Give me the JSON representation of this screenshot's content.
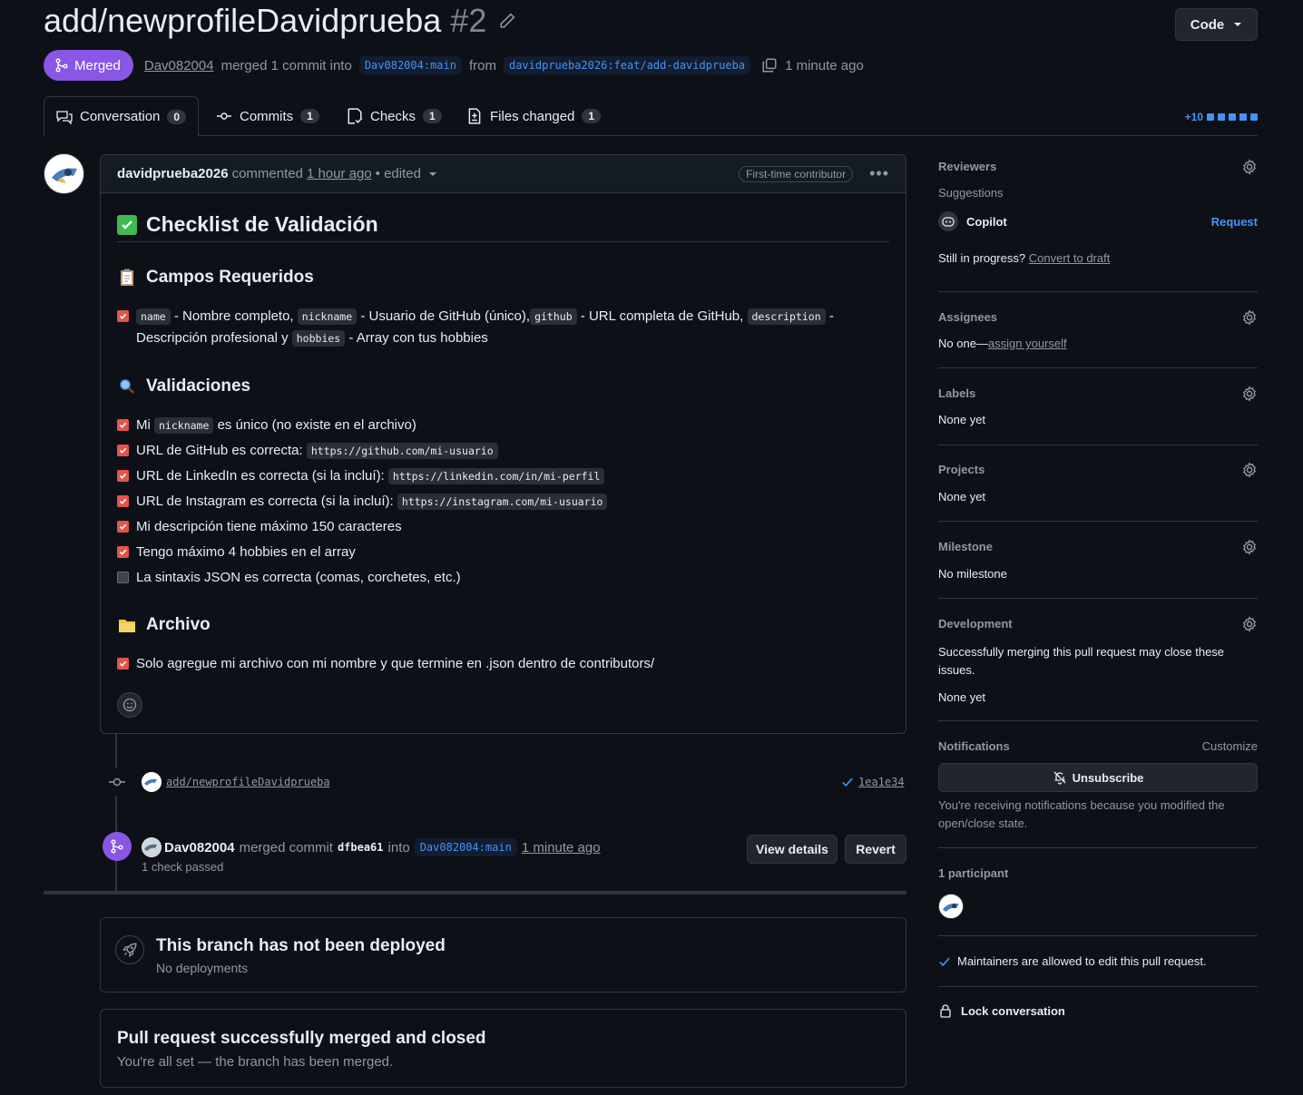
{
  "pr": {
    "title": "add/newprofileDavidprueba",
    "number": "#2",
    "state": "Merged",
    "author": "Dav082004",
    "merged_text": "merged 1 commit into",
    "base_branch": "Dav082004:main",
    "from_text": "from",
    "head_branch": "davidprueba2026:feat/add-davidprueba",
    "time": "1 minute ago"
  },
  "code_button": "Code",
  "tabs": [
    {
      "label": "Conversation",
      "count": "0"
    },
    {
      "label": "Commits",
      "count": "1"
    },
    {
      "label": "Checks",
      "count": "1"
    },
    {
      "label": "Files changed",
      "count": "1"
    }
  ],
  "diffstat": "+10",
  "comment": {
    "author": "davidprueba2026",
    "action": "commented",
    "time": "1 hour ago",
    "edited": "• edited",
    "badge": "First-time contributor",
    "heading": "Checklist de Validación",
    "sections": [
      {
        "title": "Campos Requeridos"
      },
      {
        "title": "Validaciones"
      },
      {
        "title": "Archivo"
      }
    ],
    "req": {
      "c1": "name",
      "t1": "- Nombre completo,",
      "c2": "nickname",
      "t2": "- Usuario de GitHub (único),",
      "c3": "github",
      "t3": "- URL completa de GitHub,",
      "c4": "description",
      "t4": "-",
      "t5": "Descripción profesional y",
      "c5": "hobbies",
      "t6": "- Array con tus hobbies"
    },
    "val": {
      "v1a": "Mi",
      "v1c": "nickname",
      "v1b": "es único (no existe en el archivo)",
      "v2a": "URL de GitHub es correcta:",
      "v2c": "https://github.com/mi-usuario",
      "v3a": "URL de LinkedIn es correcta (si la incluí):",
      "v3c": "https://linkedin.com/in/mi-perfil",
      "v4a": "URL de Instagram es correcta (si la incluí):",
      "v4c": "https://instagram.com/mi-usuario",
      "v5": "Mi descripción tiene máximo 150 caracteres",
      "v6": "Tengo máximo 4 hobbies en el array",
      "v7": "La sintaxis JSON es correcta (comas, corchetes, etc.)"
    },
    "file_item": "Solo agregue mi archivo con mi nombre y que termine en .json dentro de contributors/"
  },
  "timeline": {
    "commit_msg": "add/newprofileDavidprueba",
    "commit_sha": "1ea1e34",
    "merge_author": "Dav082004",
    "merge_text": "merged commit",
    "merge_sha": "dfbea61",
    "into": "into",
    "merge_branch": "Dav082004:main",
    "merge_time": "1 minute ago",
    "checks": "1 check passed",
    "view_details": "View details",
    "revert": "Revert"
  },
  "deploy": {
    "title": "This branch has not been deployed",
    "subtitle": "No deployments"
  },
  "merged_box": {
    "title": "Pull request successfully merged and closed",
    "subtitle": "You're all set — the branch has been merged."
  },
  "sidebar": {
    "reviewers": "Reviewers",
    "suggestions": "Suggestions",
    "copilot": "Copilot",
    "request": "Request",
    "still": "Still in progress?",
    "draft": "Convert to draft",
    "assignees": "Assignees",
    "no_one": "No one—",
    "assign": "assign yourself",
    "labels": "Labels",
    "labels_val": "None yet",
    "projects": "Projects",
    "projects_val": "None yet",
    "milestone": "Milestone",
    "milestone_val": "No milestone",
    "development": "Development",
    "dev_text": "Successfully merging this pull request may close these issues.",
    "dev_val": "None yet",
    "notifications": "Notifications",
    "customize": "Customize",
    "unsubscribe": "Unsubscribe",
    "notif_text": "You're receiving notifications because you modified the open/close state.",
    "participants": "1 participant",
    "maintainers": "Maintainers are allowed to edit this pull request.",
    "lock": "Lock conversation"
  }
}
